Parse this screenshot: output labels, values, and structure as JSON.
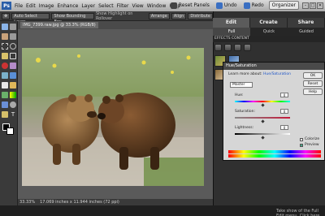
{
  "titlebar": {
    "app_logo": "Ps",
    "menus": [
      "File",
      "Edit",
      "Image",
      "Enhance",
      "Layer",
      "Select",
      "Filter",
      "View",
      "Window",
      "Help"
    ],
    "reset_panels": "Reset Panels",
    "undo": "Undo",
    "redo": "Redo",
    "organizer": "Organizer",
    "window_controls": [
      "–",
      "□",
      "✕"
    ]
  },
  "options_bar": {
    "auto_select_layer": "Auto Select Layer",
    "show_bounding_box": "Show Bounding Box",
    "show_highlight": "Show Highlight on Rollover",
    "arrange": "Arrange",
    "align": "Align",
    "distribute": "Distribute"
  },
  "document": {
    "tab_name": "IMG_7399.raw.jpg @ 33.3% (RGB/8)",
    "zoom": "33.33%",
    "doc_size": "17.069 inches x 11.944 inches (72 ppi)"
  },
  "panel": {
    "tabs": [
      "Edit",
      "Create",
      "Share"
    ],
    "active_tab": "Edit",
    "subtabs": [
      "Full",
      "Quick",
      "Guided"
    ],
    "active_subtab": "Full",
    "effects_label": "EFFECTS   CONTENT",
    "filter_select": "Textures",
    "layers_label": "LAYERS"
  },
  "dialog": {
    "title": "Hue/Saturation",
    "learn_text": "Learn more about:",
    "learn_link": "Hue/Saturation",
    "edit_select": "Master",
    "buttons": [
      "OK",
      "Reset",
      "Help"
    ],
    "hue_label": "Hue:",
    "hue_value": "0",
    "saturation_label": "Saturation:",
    "saturation_value": "0",
    "lightness_label": "Lightness:",
    "lightness_value": "0",
    "colorize": "Colorize",
    "preview": "Preview"
  },
  "project_bin": {
    "tip": "Take show of the Full Edit menu. Click here."
  },
  "colors": {
    "accent": "#2a5ea8",
    "panel_bg": "#303030",
    "dialog_bg": "#d6d6d6"
  },
  "icons": [
    "move-tool-icon",
    "zoom-tool-icon",
    "hand-tool-icon",
    "eyedropper-icon",
    "marquee-icon",
    "lasso-icon",
    "magic-wand-icon",
    "crop-icon",
    "brush-icon",
    "eraser-icon",
    "fill-icon",
    "gradient-icon",
    "type-icon",
    "shape-icon",
    "foreground-color-icon"
  ]
}
